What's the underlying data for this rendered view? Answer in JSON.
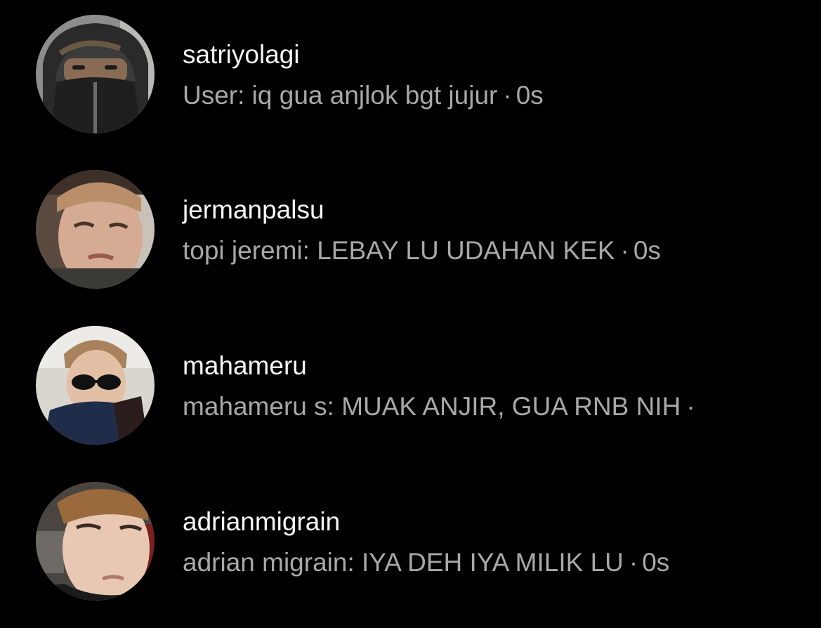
{
  "conversations": [
    {
      "username": "satriyolagi",
      "preview": "User: iq gua anjlok bgt jujur",
      "separator": "·",
      "time": "0s",
      "avatar": "avatar-hooded-jacket-photo"
    },
    {
      "username": "jermanpalsu",
      "preview": "topi jeremi: LEBAY LU UDAHAN KEK",
      "separator": "·",
      "time": "0s",
      "avatar": "avatar-squinting-face-photo"
    },
    {
      "username": "mahameru",
      "preview": "mahameru s: MUAK ANJIR, GUA RNB NIH",
      "separator": "·",
      "time": "",
      "avatar": "avatar-sunglasses-photo"
    },
    {
      "username": "adrianmigrain",
      "preview": "adrian migrain: IYA DEH IYA MILIK LU",
      "separator": "·",
      "time": "0s",
      "avatar": "avatar-closeup-face-photo"
    }
  ],
  "colors": {
    "background": "#000000",
    "username": "#f5f5f5",
    "preview": "#a8a8a8"
  }
}
